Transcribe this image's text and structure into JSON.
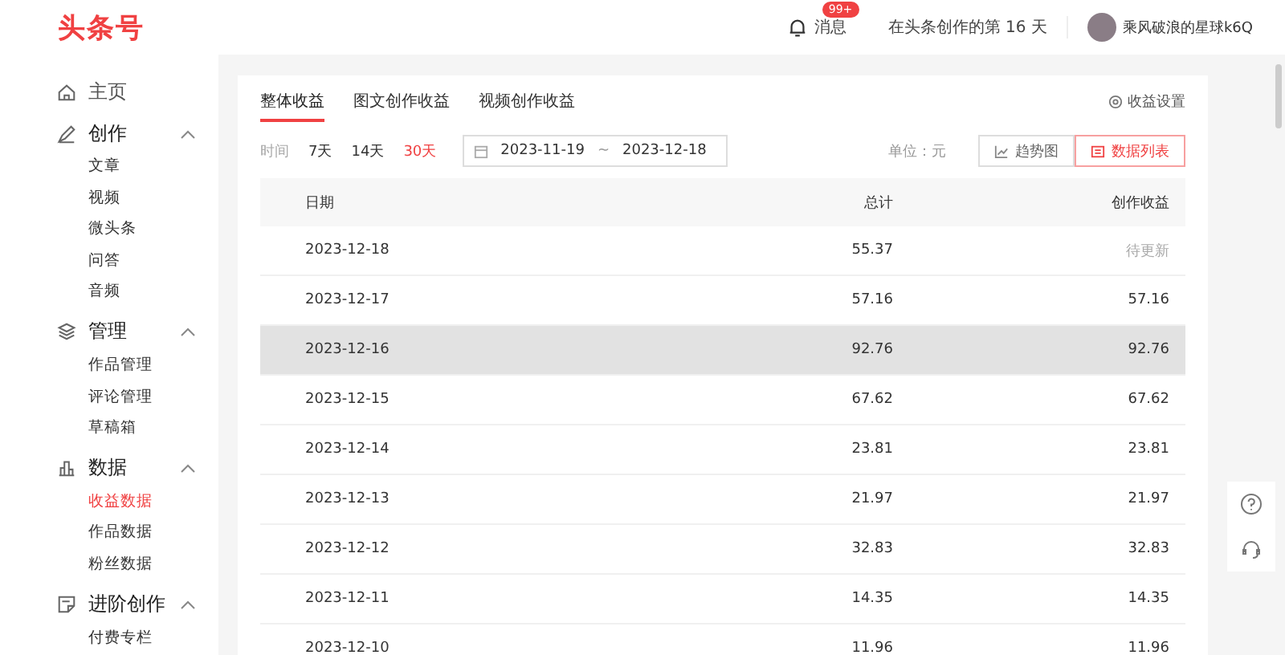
{
  "header": {
    "logo": "头条号",
    "messages": {
      "label": "消息",
      "badge": "99+"
    },
    "days_text": "在头条创作的第 16 天",
    "user_name": "乘风破浪的星球k6Q"
  },
  "sidebar": {
    "sections": [
      {
        "kind": "home",
        "label": "主页"
      },
      {
        "kind": "create",
        "label": "创作",
        "expanded": true,
        "children": [
          {
            "label": "文章",
            "selected": false
          },
          {
            "label": "视频",
            "selected": false
          },
          {
            "label": "微头条",
            "selected": false
          },
          {
            "label": "问答",
            "selected": false
          },
          {
            "label": "音频",
            "selected": false
          }
        ]
      },
      {
        "kind": "manage",
        "label": "管理",
        "expanded": true,
        "children": [
          {
            "label": "作品管理",
            "selected": false
          },
          {
            "label": "评论管理",
            "selected": false
          },
          {
            "label": "草稿箱",
            "selected": false
          }
        ]
      },
      {
        "kind": "data",
        "label": "数据",
        "expanded": true,
        "children": [
          {
            "label": "收益数据",
            "selected": true
          },
          {
            "label": "作品数据",
            "selected": false
          },
          {
            "label": "粉丝数据",
            "selected": false
          }
        ]
      },
      {
        "kind": "advanced",
        "label": "进阶创作",
        "expanded": true,
        "children": [
          {
            "label": "付费专栏",
            "selected": false
          }
        ]
      }
    ]
  },
  "tabs": [
    {
      "label": "整体收益",
      "selected": true
    },
    {
      "label": "图文创作收益",
      "selected": false
    },
    {
      "label": "视频创作收益",
      "selected": false
    }
  ],
  "settings_link": "收益设置",
  "filter": {
    "label": "时间",
    "ranges": [
      {
        "label": "7天",
        "selected": false
      },
      {
        "label": "14天",
        "selected": false
      },
      {
        "label": "30天",
        "selected": true
      }
    ],
    "start_date": "2023-11-19",
    "separator": "~",
    "end_date": "2023-12-18",
    "unit": "单位：元"
  },
  "views": [
    {
      "kind": "chart",
      "label": "趋势图",
      "selected": false
    },
    {
      "kind": "table",
      "label": "数据列表",
      "selected": true
    }
  ],
  "table": {
    "columns": [
      "日期",
      "总计",
      "创作收益"
    ],
    "rows": [
      {
        "cells": [
          "2023-12-18",
          "55.37",
          "待更新"
        ],
        "pending": true,
        "hovered": false
      },
      {
        "cells": [
          "2023-12-17",
          "57.16",
          "57.16"
        ],
        "pending": false,
        "hovered": false
      },
      {
        "cells": [
          "2023-12-16",
          "92.76",
          "92.76"
        ],
        "pending": false,
        "hovered": true
      },
      {
        "cells": [
          "2023-12-15",
          "67.62",
          "67.62"
        ],
        "pending": false,
        "hovered": false
      },
      {
        "cells": [
          "2023-12-14",
          "23.81",
          "23.81"
        ],
        "pending": false,
        "hovered": false
      },
      {
        "cells": [
          "2023-12-13",
          "21.97",
          "21.97"
        ],
        "pending": false,
        "hovered": false
      },
      {
        "cells": [
          "2023-12-12",
          "32.83",
          "32.83"
        ],
        "pending": false,
        "hovered": false
      },
      {
        "cells": [
          "2023-12-11",
          "14.35",
          "14.35"
        ],
        "pending": false,
        "hovered": false
      },
      {
        "cells": [
          "2023-12-10",
          "11.96",
          "11.96"
        ],
        "pending": false,
        "hovered": false
      }
    ]
  }
}
